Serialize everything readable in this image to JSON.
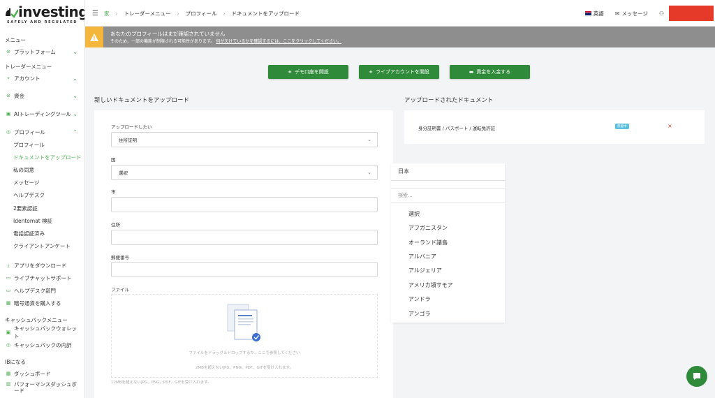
{
  "logo": {
    "text": "investing",
    "tagline": "SAFELY AND REGULATED"
  },
  "sidebar": {
    "menu_label": "メニュー",
    "platform": "プラットフォーム",
    "trader_menu_label": "トレーダーメニュー",
    "account": "アカウント",
    "funds": "資金",
    "ai_tools": "AIトレーディングツール",
    "profile": "プロフィール",
    "profile_sub": [
      "プロフィール",
      "ドキュメントをアップロード",
      "私の同意",
      "メッセージ",
      "ヘルプデスク",
      "2要素認証",
      "Identomat 検証",
      "電話認証済み",
      "クライアントアンケート"
    ],
    "download_app": "アプリをダウンロード",
    "live_chat": "ライブチャットサポート",
    "helpdesk_dept": "ヘルプデスク部門",
    "buy_crypto": "暗号通貨を購入する",
    "cashback_menu_label": "キャッシュバックメニュー",
    "cashback_wallet": "キャッシュバックウォレット",
    "cashback_details": "キャッシュバックの内訳",
    "ib_label": "IBになる",
    "dashboard": "ダッシュボード",
    "perf_dashboard": "パフォーマンスダッシュボード"
  },
  "breadcrumb": [
    "家",
    "トレーダーメニュー",
    "プロフィール",
    "ドキュメントをアップロード"
  ],
  "topbar": {
    "language": "英語",
    "messages": "メッセージ"
  },
  "alert": {
    "title": "あなたのプロフィールはまだ確認されていません",
    "sub_text": "そのため、一部の機能が制限される可能性があります。",
    "sub_link": "何が欠けているかを確認するには、ここをクリックしてください。"
  },
  "actions": {
    "demo": "デモ口座を開設",
    "live": "ライブアカウントを開設",
    "deposit": "資金を入金する"
  },
  "upload_form": {
    "heading": "新しいドキュメントをアップロード",
    "want_label": "アップロードしたい",
    "want_value": "住所証明",
    "country_label": "国",
    "country_value": "選択",
    "city_label": "市",
    "address_label": "住所",
    "postal_label": "郵便番号",
    "file_label": "ファイル",
    "drop_text": "ファイルをドラッグ＆ドロップするか、ここで参照してください",
    "drop_hint": "2MBを超えないJPG、PNG、PDF、GIFを受け入れます。",
    "bottom_hint": "12MBを超えないJPG、PNG、PDF、GIFを受け入れます。"
  },
  "uploaded": {
    "heading": "アップロードされたドキュメント",
    "doc_name": "身分証明書 / パスポート / 運転免許証",
    "status": "保留中",
    "delete_icon": "×"
  },
  "country_dropdown": {
    "selected": "日本",
    "search_placeholder": "検索...",
    "options": [
      "選択",
      "アフガニスタン",
      "オーランド諸島",
      "アルバニア",
      "アルジェリア",
      "アメリカ領サモア",
      "アンドラ",
      "アンゴラ"
    ]
  },
  "colors": {
    "accent": "#4caf50",
    "button": "#2f8a3a",
    "alert_bg": "#8e8e8e",
    "alert_icon": "#f4b73b",
    "redacted": "#e53a2a"
  }
}
